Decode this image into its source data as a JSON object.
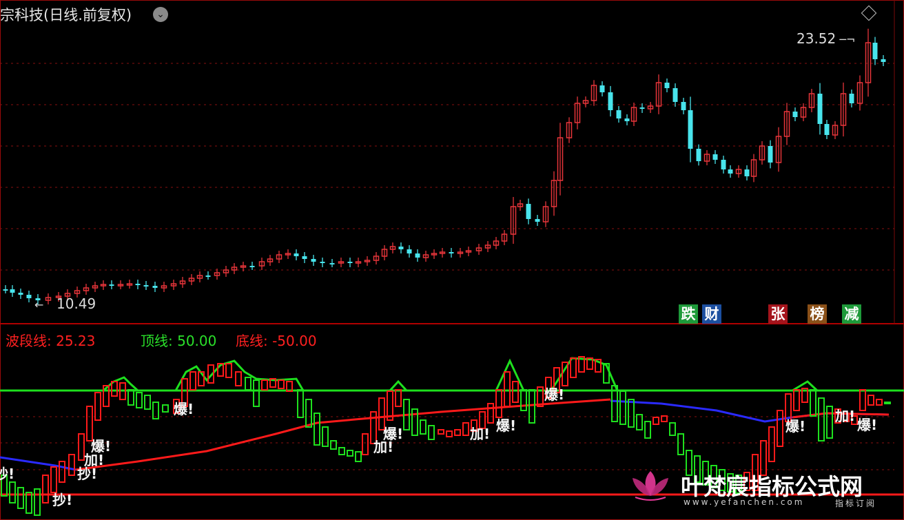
{
  "header": {
    "title": "宗科技(日线.前复权)",
    "max_label": "23.52",
    "min_label": "10.49"
  },
  "indicator": {
    "wave_label": "波段线: 25.23",
    "top_label": "顶线: 50.00",
    "bottom_label": "底线: -50.00"
  },
  "tags": [
    {
      "text": "跌",
      "color": "#1e9a3a",
      "fg": "#ffffff"
    },
    {
      "text": "财",
      "color": "#1c4fa0",
      "fg": "#ffffff"
    },
    {
      "text": "张",
      "color": "#a4141c",
      "fg": "#ffffff"
    },
    {
      "text": "榜",
      "color": "#8a5018",
      "fg": "#ffffff"
    },
    {
      "text": "减",
      "color": "#1e9a3a",
      "fg": "#ffffff"
    }
  ],
  "markers": [
    "抄!",
    "抄!",
    "加!",
    "爆!",
    "爆!",
    "加!",
    "爆!",
    "加!",
    "爆!",
    "爆!",
    "爆!",
    "加!",
    "爆!"
  ],
  "watermark": {
    "text": "叶梵宸指标公式网",
    "url": "www.yefanchen.com",
    "sub": "指标订阅"
  },
  "colors": {
    "up": "#e8353a",
    "down": "#48e4ec",
    "green": "#1ee01e",
    "red": "#ff1a1a",
    "blue": "#2a2aff",
    "grid": "#8a1010"
  },
  "chart_data": {
    "type": "candlestick",
    "price_max": 23.52,
    "price_min": 10.49,
    "indicator_top": 50.0,
    "indicator_bottom": -50.0,
    "wave_value": 25.23
  }
}
